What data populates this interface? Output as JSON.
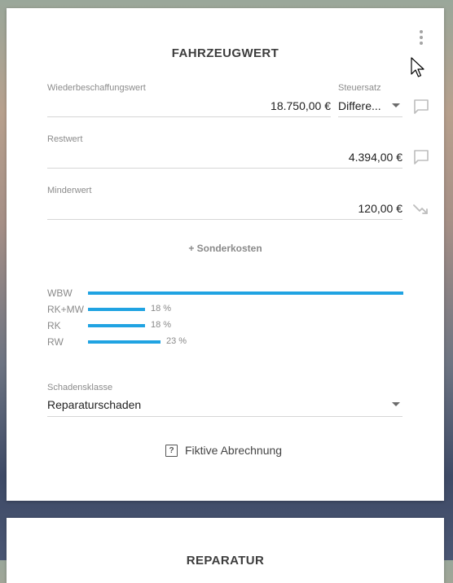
{
  "fahrzeugwert": {
    "title": "FAHRZEUGWERT",
    "wbw": {
      "label": "Wiederbeschaffungswert",
      "value": "18.750,00 €"
    },
    "steuersatz": {
      "label": "Steuersatz",
      "value": "Differe..."
    },
    "restwert": {
      "label": "Restwert",
      "value": "4.394,00 €"
    },
    "minderwert": {
      "label": "Minderwert",
      "value": "120,00 €"
    },
    "sonderkosten_label": "+ Sonderkosten",
    "bars": [
      {
        "label": "WBW",
        "fraction": 1.0,
        "pct_text": ""
      },
      {
        "label": "RK+MW",
        "fraction": 0.18,
        "pct_text": "18 %"
      },
      {
        "label": "RK",
        "fraction": 0.18,
        "pct_text": "18 %"
      },
      {
        "label": "RW",
        "fraction": 0.23,
        "pct_text": "23 %"
      }
    ],
    "schadensklasse": {
      "label": "Schadensklasse",
      "value": "Reparaturschaden"
    },
    "fiktiv": {
      "icon_glyph": "?",
      "label": "Fiktive Abrechnung"
    }
  },
  "next_card": {
    "title": "REPARATUR"
  },
  "icons": {
    "menu": "more-vert-icon",
    "comment": "comment-icon",
    "trending_down": "trending-down-icon",
    "help": "help-box-icon",
    "cursor": "mouse-pointer-icon"
  },
  "colors": {
    "bar": "#20a3e2",
    "icon_grey": "#bdbdbd"
  }
}
